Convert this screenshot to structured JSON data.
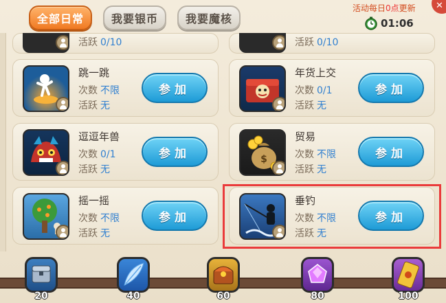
{
  "tabs": [
    {
      "label": "全部日常",
      "active": true
    },
    {
      "label": "我要银币",
      "active": false
    },
    {
      "label": "我要魔核",
      "active": false
    }
  ],
  "refresh_notice": {
    "prefix": "活动每日",
    "time": "0点",
    "suffix": "更新"
  },
  "timer": "01:06",
  "labels": {
    "count": "次数",
    "activity": "活跃",
    "join": "参加"
  },
  "top_partial": [
    {
      "activity_value": "0/10"
    },
    {
      "activity_value": "0/10"
    }
  ],
  "activities": [
    {
      "name": "跳一跳",
      "count": "不限",
      "activity": "无",
      "icon": "jump-icon",
      "color": "#2d8fd1"
    },
    {
      "name": "年货上交",
      "count": "0/1",
      "activity": "无",
      "icon": "new-year-goods-icon",
      "color": "#c23a2a"
    },
    {
      "name": "逗逗年兽",
      "count": "0/1",
      "activity": "无",
      "icon": "nian-beast-icon",
      "color": "#1d4f7a"
    },
    {
      "name": "贸易",
      "count": "不限",
      "activity": "无",
      "icon": "trade-coins-icon",
      "color": "#2a2a2a"
    },
    {
      "name": "摇一摇",
      "count": "不限",
      "activity": "无",
      "icon": "shake-tree-icon",
      "color": "#4a8fd0"
    },
    {
      "name": "垂钓",
      "count": "不限",
      "activity": "无",
      "icon": "fishing-icon",
      "color": "#2e6fb0"
    }
  ],
  "rewards": [
    {
      "value": "20",
      "icon": "silver-chest-icon",
      "color": "#3b6fa8"
    },
    {
      "value": "40",
      "icon": "feather-icon",
      "color": "#2c6fd0"
    },
    {
      "value": "60",
      "icon": "gold-chest-icon",
      "color": "#c08a1d"
    },
    {
      "value": "80",
      "icon": "purple-gem-icon",
      "color": "#7a3fb0"
    },
    {
      "value": "100",
      "icon": "golden-ticket-icon",
      "color": "#8a3fb0"
    }
  ]
}
